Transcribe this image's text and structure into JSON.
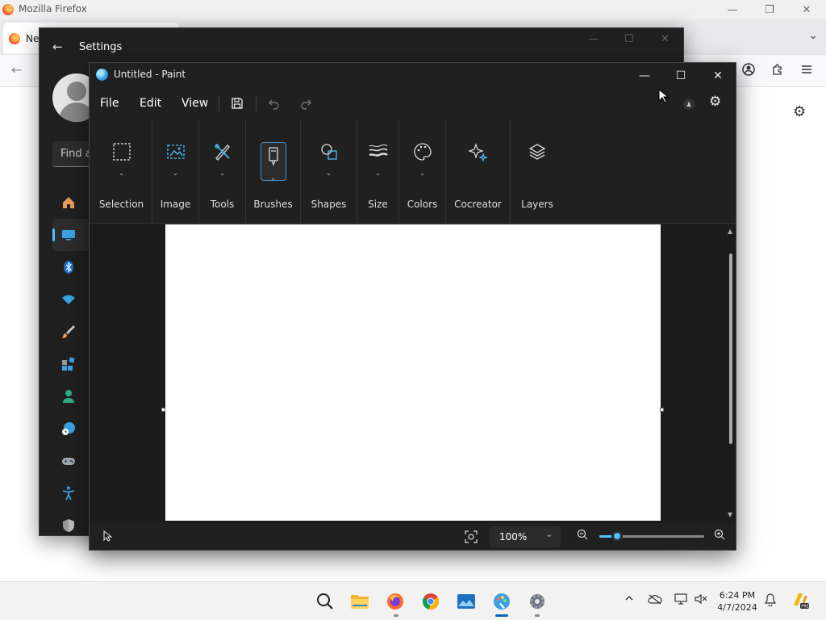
{
  "firefox": {
    "window_title": "Mozilla Firefox",
    "tab_label": "Ne",
    "controls": {
      "minimize": "—",
      "maximize": "❐",
      "close": "✕"
    }
  },
  "settings": {
    "title": "Settings",
    "search_placeholder": "Find a setting",
    "nav_icons": [
      "home-icon",
      "system-icon",
      "bluetooth-icon",
      "network-icon",
      "personalization-icon",
      "apps-icon",
      "accounts-icon",
      "time-language-icon",
      "gaming-icon",
      "accessibility-icon",
      "privacy-icon"
    ]
  },
  "paint": {
    "title": "Untitled - Paint",
    "menu": {
      "file": "File",
      "edit": "Edit",
      "view": "View"
    },
    "ribbon": [
      {
        "id": "selection",
        "label": "Selection"
      },
      {
        "id": "image",
        "label": "Image"
      },
      {
        "id": "tools",
        "label": "Tools"
      },
      {
        "id": "brushes",
        "label": "Brushes",
        "selected": true
      },
      {
        "id": "shapes",
        "label": "Shapes"
      },
      {
        "id": "size",
        "label": "Size"
      },
      {
        "id": "colors",
        "label": "Colors"
      },
      {
        "id": "cocreator",
        "label": "Cocreator"
      },
      {
        "id": "layers",
        "label": "Layers"
      }
    ],
    "status": {
      "zoom_value": "100%",
      "zoom_fraction": 0.17
    },
    "accent_color": "#4cc2ff"
  },
  "taskbar": {
    "apps": [
      "search-icon",
      "file-explorer-icon",
      "firefox-icon",
      "chrome-icon",
      "photos-icon",
      "paint-icon",
      "settings-icon"
    ],
    "time": "6:24 PM",
    "date": "4/7/2024"
  }
}
